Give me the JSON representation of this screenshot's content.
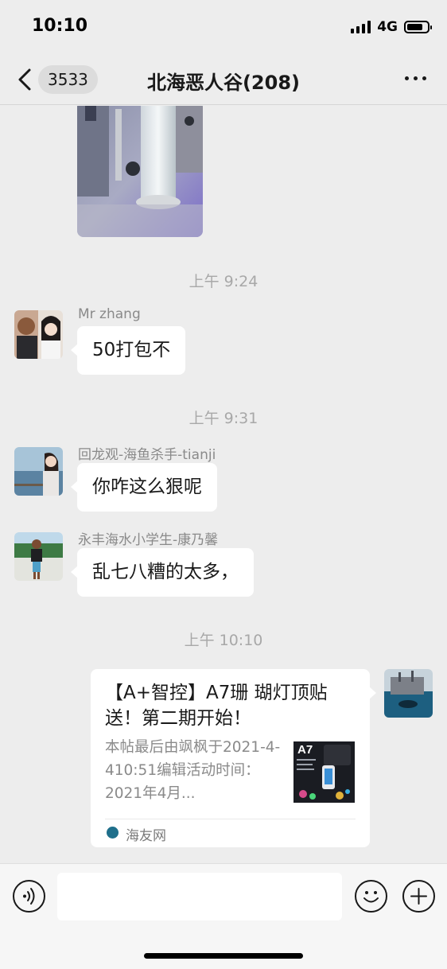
{
  "status_bar": {
    "time": "10:10",
    "network": "4G",
    "battery_level": 0.8
  },
  "nav": {
    "back_icon": "chevron-left-icon",
    "unread_count": "3533",
    "title": "北海恶人谷(208)",
    "more_icon": "more-dots-icon"
  },
  "messages": [
    {
      "type": "image",
      "direction": "incoming"
    },
    {
      "type": "time",
      "text": "上午 9:24"
    },
    {
      "type": "text",
      "sender": "Mr zhang",
      "text": "50打包不"
    },
    {
      "type": "time",
      "text": "上午 9:31"
    },
    {
      "type": "text",
      "sender": "回龙观-海鱼杀手-tianji",
      "text": "你咋这么狠呢"
    },
    {
      "type": "text",
      "sender": "永丰海水小学生-康乃馨",
      "text": "乱七八糟的太多，"
    },
    {
      "type": "time",
      "text": "上午 10:10"
    },
    {
      "type": "link",
      "direction": "outgoing",
      "title": "【A+智控】A7珊 瑚灯顶贴送！第二期开始！",
      "description": "本帖最后由飒枫于2021-4-410:51编辑活动时间：2021年4月...",
      "thumb_label": "A7",
      "source": "海友网"
    }
  ],
  "input_bar": {
    "voice_icon": "voice-icon",
    "message_value": "",
    "emoji_icon": "emoji-icon",
    "plus_icon": "plus-circle-icon"
  },
  "colors": {
    "background": "#ededed",
    "bubble": "#ffffff",
    "text": "#191919",
    "timestamp": "#a8a8a8"
  }
}
